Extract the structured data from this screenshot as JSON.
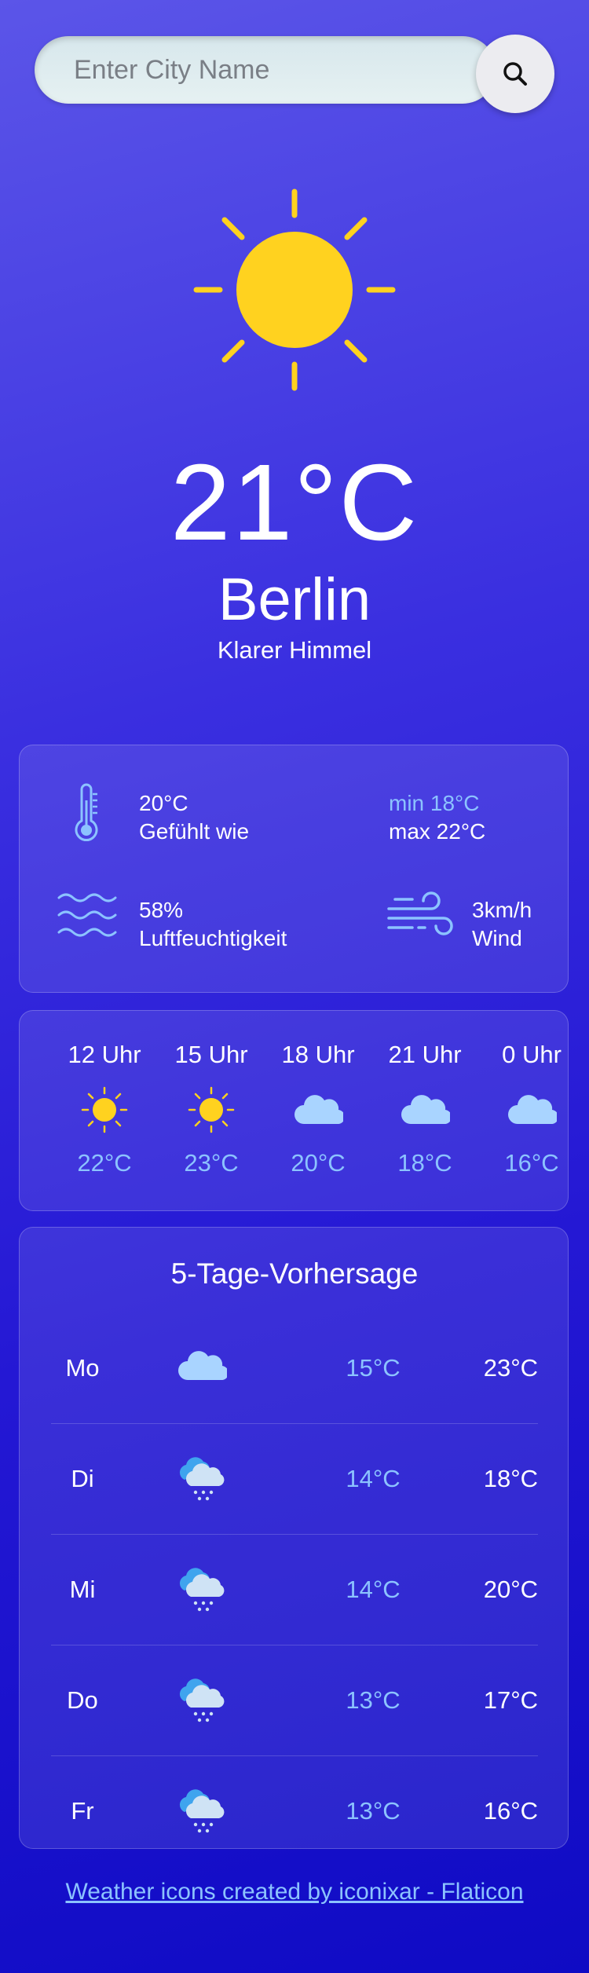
{
  "search": {
    "placeholder": "Enter City Name"
  },
  "current": {
    "temperature": "21°C",
    "city": "Berlin",
    "condition": "Klarer Himmel",
    "feels_like_value": "20°C",
    "feels_like_label": "Gefühlt wie",
    "min": "min 18°C",
    "max": "max 22°C",
    "humidity_value": "58%",
    "humidity_label": "Luftfeuchtigkeit",
    "wind_value": "3km/h",
    "wind_label": "Wind"
  },
  "hourly": [
    {
      "time": "12 Uhr",
      "icon": "sun-icon",
      "temp": "22°C"
    },
    {
      "time": "15 Uhr",
      "icon": "sun-icon",
      "temp": "23°C"
    },
    {
      "time": "18 Uhr",
      "icon": "cloud-icon",
      "temp": "20°C"
    },
    {
      "time": "21 Uhr",
      "icon": "cloud-icon",
      "temp": "18°C"
    },
    {
      "time": "0 Uhr",
      "icon": "cloud-icon",
      "temp": "16°C"
    }
  ],
  "forecast": {
    "title": "5-Tage-Vorhersage",
    "days": [
      {
        "day": "Mo",
        "icon": "cloud-icon",
        "min": "15°C",
        "max": "23°C"
      },
      {
        "day": "Di",
        "icon": "rain-cloud-icon",
        "min": "14°C",
        "max": "18°C"
      },
      {
        "day": "Mi",
        "icon": "rain-cloud-icon",
        "min": "14°C",
        "max": "20°C"
      },
      {
        "day": "Do",
        "icon": "rain-cloud-icon",
        "min": "13°C",
        "max": "17°C"
      },
      {
        "day": "Fr",
        "icon": "rain-cloud-icon",
        "min": "13°C",
        "max": "16°C"
      }
    ]
  },
  "footer": {
    "credit": "Weather icons created by iconixar - Flaticon"
  },
  "colors": {
    "accent_blue": "#8cc3ff",
    "sun": "#ffd21f",
    "background": "#3a2fe0"
  }
}
